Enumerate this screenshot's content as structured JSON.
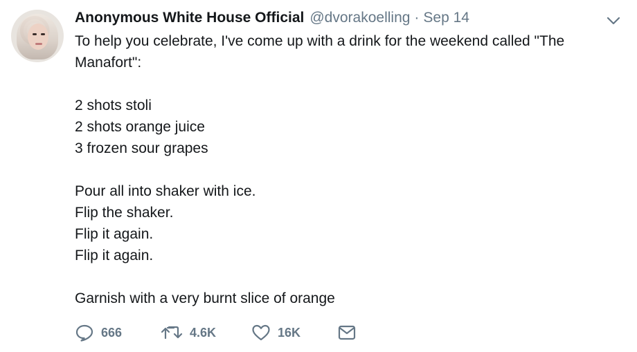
{
  "author": {
    "name": "Anonymous White House Official",
    "handle": "@dvorakoelling",
    "separator": "·",
    "date": "Sep 14"
  },
  "tweet": {
    "lines": [
      "To help you celebrate, I've come up with a drink for the weekend called \"The",
      "Manafort\":",
      "",
      "2 shots stoli",
      "2 shots orange juice",
      "3 frozen sour grapes",
      "",
      "Pour all into shaker with ice.",
      "Flip the shaker.",
      "Flip it again.",
      "Flip it again.",
      "",
      "Garnish with a very burnt slice of orange"
    ]
  },
  "actions": {
    "reply_count": "666",
    "retweet_count": "4.6K",
    "like_count": "16K"
  },
  "icons": {
    "reply": "reply-icon",
    "retweet": "retweet-icon",
    "like": "heart-icon",
    "dm": "envelope-icon",
    "menu": "chevron-down-icon"
  },
  "colors": {
    "text": "#14171a",
    "muted": "#657786"
  }
}
